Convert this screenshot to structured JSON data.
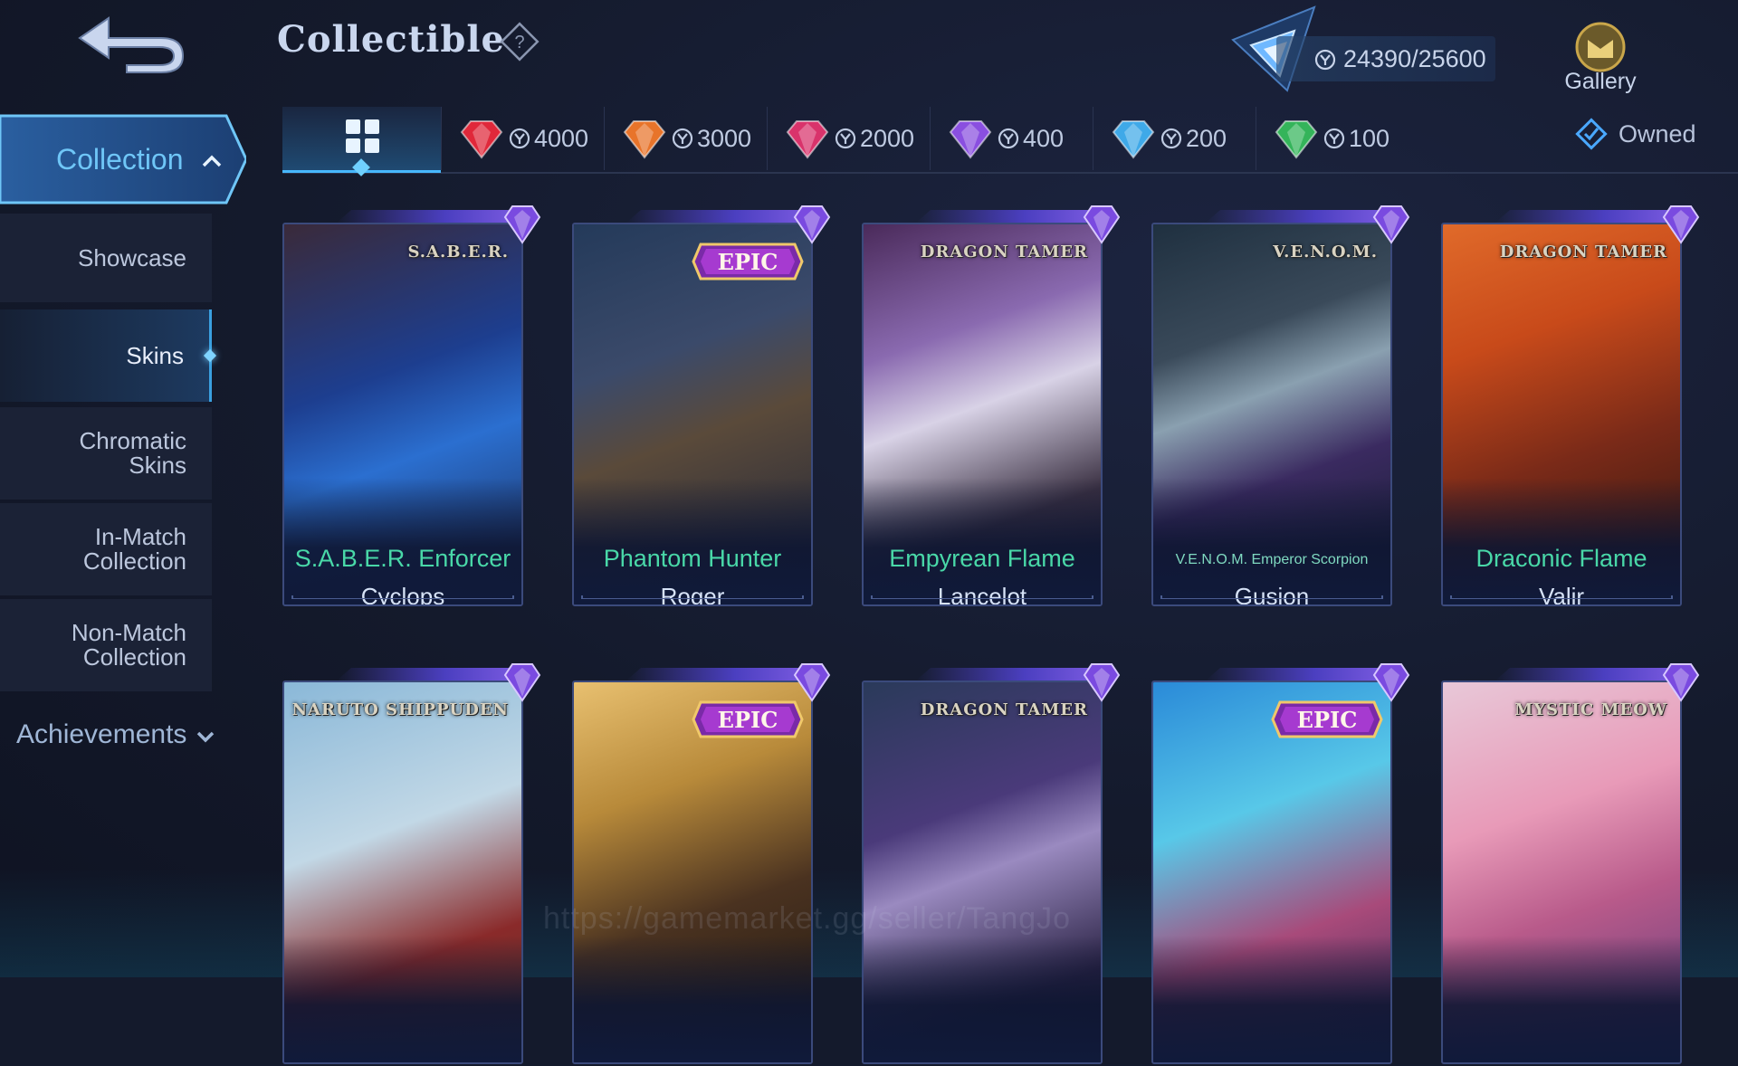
{
  "header": {
    "title": "Collectible",
    "points": "24390/25600",
    "gallery_label": "Gallery"
  },
  "sidebar": {
    "collection_label": "Collection",
    "items": [
      {
        "label": "Showcase"
      },
      {
        "label": "Skins"
      },
      {
        "label": "Chromatic\nSkins"
      },
      {
        "label": "In-Match\nCollection"
      },
      {
        "label": "Non-Match\nCollection"
      }
    ],
    "achievements_label": "Achievements"
  },
  "filters": [
    {
      "value": "4000",
      "color": "#e0283a"
    },
    {
      "value": "3000",
      "color": "#e8742a"
    },
    {
      "value": "2000",
      "color": "#d9336b"
    },
    {
      "value": "400",
      "color": "#8a4fe0"
    },
    {
      "value": "200",
      "color": "#3fa9e8"
    },
    {
      "value": "100",
      "color": "#34b45a"
    }
  ],
  "owned_label": "Owned",
  "cards": [
    {
      "series": "S.A.B.E.R.",
      "skin": "S.A.B.E.R. Enforcer",
      "hero": "Cyclops",
      "epic": false
    },
    {
      "series": "",
      "badge": "EPIC",
      "skin": "Phantom Hunter",
      "hero": "Roger",
      "epic": true
    },
    {
      "series": "DRAGON TAMER",
      "skin": "Empyrean Flame",
      "hero": "Lancelot",
      "epic": false
    },
    {
      "series": "V.E.N.O.M.",
      "skin": "V.E.N.O.M. Emperor Scorpion",
      "hero": "Gusion",
      "epic": false
    },
    {
      "series": "DRAGON TAMER",
      "skin": "Draconic Flame",
      "hero": "Valir",
      "epic": false
    },
    {
      "series": "NARUTO SHIPPUDEN",
      "skin": "",
      "hero": "",
      "epic": false
    },
    {
      "series": "",
      "badge": "EPIC",
      "skin": "",
      "hero": "",
      "epic": true
    },
    {
      "series": "DRAGON TAMER",
      "skin": "",
      "hero": "",
      "epic": false
    },
    {
      "series": "",
      "badge": "EPIC",
      "skin": "",
      "hero": "",
      "epic": true
    },
    {
      "series": "MYSTIC MEOW",
      "skin": "",
      "hero": "",
      "epic": false
    }
  ],
  "watermark": "https://gamemarket.gg/seller/TangJo"
}
